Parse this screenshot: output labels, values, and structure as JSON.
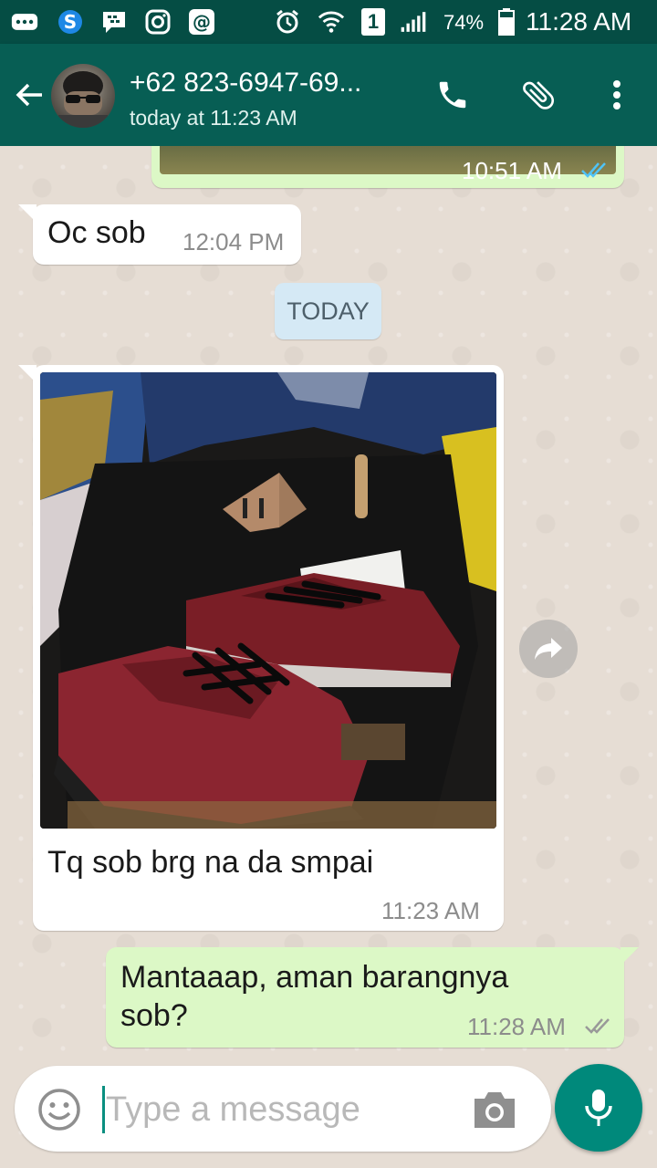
{
  "status_bar": {
    "battery": "74%",
    "time": "11:28 AM",
    "sim_slot": "1",
    "icons": [
      "more-icon",
      "skype-icon",
      "bbm-icon",
      "instagram-icon",
      "email-icon",
      "alarm-icon",
      "wifi-icon",
      "sim-icon",
      "signal-icon",
      "battery-icon"
    ]
  },
  "header": {
    "contact_name": "+62 823-6947-69...",
    "last_seen": "today at 11:23 AM",
    "icons": [
      "back-icon",
      "phone-icon",
      "attach-icon",
      "more-vert-icon"
    ]
  },
  "messages": [
    {
      "direction": "out",
      "type": "image-partial",
      "time": "10:51 AM",
      "status": "read"
    },
    {
      "direction": "in",
      "type": "text",
      "text": "Oc sob",
      "time": "12:04 PM"
    },
    {
      "direction": "system",
      "type": "date",
      "text": "TODAY"
    },
    {
      "direction": "in",
      "type": "image",
      "caption": "Tq sob brg na da smpai",
      "time": "11:23 AM",
      "image_desc": "red sneakers on black backpack"
    },
    {
      "direction": "out",
      "type": "text",
      "text": "Mantaaap, aman barangnya sob?",
      "time": "11:28 AM",
      "status": "delivered"
    }
  ],
  "input": {
    "placeholder": "Type a message",
    "icons": [
      "emoji-icon",
      "camera-icon",
      "mic-icon"
    ]
  },
  "colors": {
    "status_bar": "#054d44",
    "app_bar": "#075e54",
    "outgoing_bubble": "#dcf8c6",
    "incoming_bubble": "#ffffff",
    "date_chip": "#d5e9f5",
    "read_tick": "#4fc3f7",
    "mic_button": "#00897b"
  }
}
